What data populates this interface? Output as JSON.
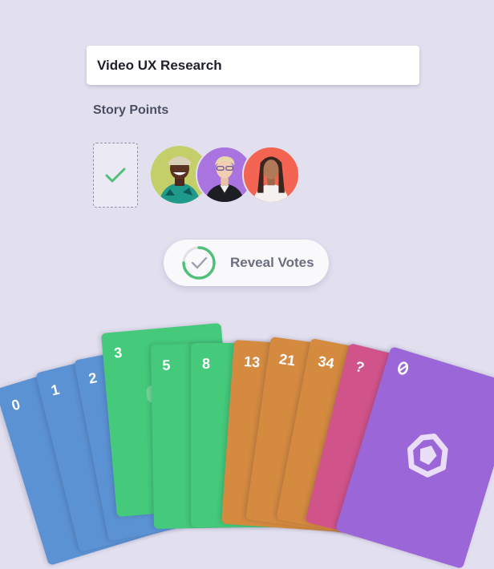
{
  "session": {
    "title_value": "Video UX Research",
    "section_label": "Story Points"
  },
  "voters": [
    {
      "name": "avatar-voter-1",
      "bg": "#c4cf6a"
    },
    {
      "name": "avatar-voter-2",
      "bg": "#a974e0"
    },
    {
      "name": "avatar-voter-3",
      "bg": "#f36452"
    }
  ],
  "reveal_button": {
    "label": "Reveal Votes",
    "progress": 0.75
  },
  "cards": [
    {
      "value": "0",
      "color": "#5b92d3"
    },
    {
      "value": "1",
      "color": "#5b92d3"
    },
    {
      "value": "2",
      "color": "#5b92d3"
    },
    {
      "value": "3",
      "color": "#45c97a"
    },
    {
      "value": "5",
      "color": "#45c97a"
    },
    {
      "value": "8",
      "color": "#45c97a"
    },
    {
      "value": "13",
      "color": "#d48a3f"
    },
    {
      "value": "21",
      "color": "#d48a3f"
    },
    {
      "value": "34",
      "color": "#d48a3f"
    },
    {
      "value": "?",
      "color": "#d0538a"
    }
  ],
  "front_card": {
    "color": "#9b66d8",
    "icon": "logo-icon"
  },
  "colors": {
    "background": "#e2e0ef",
    "accent_green": "#4fbf7a"
  }
}
